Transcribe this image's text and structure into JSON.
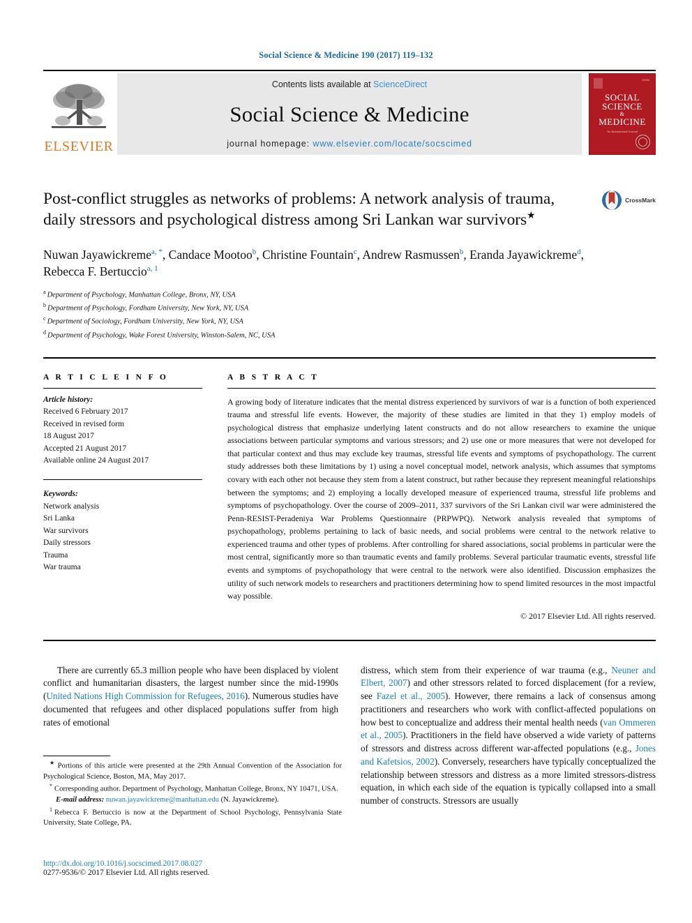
{
  "running_head": "Social Science & Medicine 190 (2017) 119–132",
  "masthead": {
    "publisher_name": "ELSEVIER",
    "publisher_logo_icon": "elsevier-tree-icon",
    "contents_prefix": "Contents lists available at ",
    "contents_link": "ScienceDirect",
    "journal_title": "Social Science & Medicine",
    "homepage_prefix": "journal homepage: ",
    "homepage_url": "www.elsevier.com/locate/socscimed",
    "cover": {
      "line1": "SOCIAL",
      "line2": "SCIENCE",
      "amp": "&",
      "line3": "MEDICINE",
      "tagline": "An International Journal",
      "top_mark": "ISSN"
    }
  },
  "article": {
    "title": "Post-conflict struggles as networks of problems: A network analysis of trauma, daily stressors and psychological distress among Sri Lankan war survivors",
    "title_star": "★",
    "crossmark_label": "CrossMark",
    "authors_line1": "Nuwan Jayawickreme",
    "authors": [
      {
        "name": "Nuwan Jayawickreme",
        "marks": "a, *"
      },
      {
        "name": "Candace Mootoo",
        "marks": "b"
      },
      {
        "name": "Christine Fountain",
        "marks": "c"
      },
      {
        "name": "Andrew Rasmussen",
        "marks": "b"
      },
      {
        "name": "Eranda Jayawickreme",
        "marks": "d"
      },
      {
        "name": "Rebecca F. Bertuccio",
        "marks": "a, 1"
      }
    ],
    "affiliations": [
      {
        "mark": "a",
        "text": "Department of Psychology, Manhattan College, Bronx, NY, USA"
      },
      {
        "mark": "b",
        "text": "Department of Psychology, Fordham University, New York, NY, USA"
      },
      {
        "mark": "c",
        "text": "Department of Sociology, Fordham University, New York, NY, USA"
      },
      {
        "mark": "d",
        "text": "Department of Psychology, Wake Forest University, Winston-Salem, NC, USA"
      }
    ]
  },
  "article_info": {
    "heading": "A R T I C L E   I N F O",
    "history_label": "Article history:",
    "history": [
      "Received 6 February 2017",
      "Received in revised form",
      "18 August 2017",
      "Accepted 21 August 2017",
      "Available online 24 August 2017"
    ],
    "keywords_label": "Keywords:",
    "keywords": [
      "Network analysis",
      "Sri Lanka",
      "War survivors",
      "Daily stressors",
      "Trauma",
      "War trauma"
    ]
  },
  "abstract": {
    "heading": "A B S T R A C T",
    "text": "A growing body of literature indicates that the mental distress experienced by survivors of war is a function of both experienced trauma and stressful life events. However, the majority of these studies are limited in that they 1) employ models of psychological distress that emphasize underlying latent constructs and do not allow researchers to examine the unique associations between particular symptoms and various stressors; and 2) use one or more measures that were not developed for that particular context and thus may exclude key traumas, stressful life events and symptoms of psychopathology. The current study addresses both these limitations by 1) using a novel conceptual model, network analysis, which assumes that symptoms covary with each other not because they stem from a latent construct, but rather because they represent meaningful relationships between the symptoms; and 2) employing a locally developed measure of experienced trauma, stressful life problems and symptoms of psychopathology. Over the course of 2009–2011, 337 survivors of the Sri Lankan civil war were administered the Penn-RESIST-Peradeniya War Problems Questionnaire (PRPWPQ). Network analysis revealed that symptoms of psychopathology, problems pertaining to lack of basic needs, and social problems were central to the network relative to experienced trauma and other types of problems. After controlling for shared associations, social problems in particular were the most central, significantly more so than traumatic events and family problems. Several particular traumatic events, stressful life events and symptoms of psychopathology that were central to the network were also identified. Discussion emphasizes the utility of such network models to researchers and practitioners determining how to spend limited resources in the most impactful way possible.",
    "copyright": "© 2017 Elsevier Ltd. All rights reserved."
  },
  "body": {
    "left_column": {
      "seg1": "There are currently 65.3 million people who have been displaced by violent conflict and humanitarian disasters, the largest number since the mid-1990s (",
      "cite1": "United Nations High Commission for Refugees, 2016",
      "seg2": "). Numerous studies have documented that refugees and other displaced populations suffer from high rates of emotional"
    },
    "right_column": {
      "seg1": "distress, which stem from their experience of war trauma (e.g., ",
      "cite1": "Neuner and Elbert, 2007",
      "seg2": ") and other stressors related to forced displacement (for a review, see ",
      "cite2": "Fazel et al., 2005",
      "seg3": "). However, there remains a lack of consensus among practitioners and researchers who work with conflict-affected populations on how best to conceptualize and address their mental health needs (",
      "cite3": "van Ommeren et al., 2005",
      "seg4": "). Practitioners in the field have observed a wide variety of patterns of stressors and distress across different war-affected populations (e.g., ",
      "cite4": "Jones and Kafetsios, 2002",
      "seg5": "). Conversely, researchers have typically conceptualized the relationship between stressors and distress as a more limited stressors-distress equation, in which each side of the equation is typically collapsed into a small number of constructs. Stressors are usually"
    }
  },
  "footnotes": [
    {
      "mark": "★",
      "text": "Portions of this article were presented at the 29th Annual Convention of the Association for Psychological Science, Boston, MA, May 2017."
    },
    {
      "mark": "*",
      "text": "Corresponding author. Department of Psychology, Manhattan College, Bronx, NY 10471, USA."
    }
  ],
  "email_note": {
    "label": "E-mail address:",
    "email": "nuwan.jayawickreme@manhattan.edu",
    "suffix": " (N. Jayawickreme)."
  },
  "footnote_present_address": {
    "mark": "1",
    "text": "Rebecca F. Bertuccio is now at the Department of School Psychology, Pennsylvania State University, State College, PA."
  },
  "doi": {
    "url": "http://dx.doi.org/10.1016/j.socscimed.2017.08.027",
    "issn_line": "0277-9536/© 2017 Elsevier Ltd. All rights reserved."
  },
  "colors": {
    "link": "#1a7fc1",
    "running_head": "#1a6ca8",
    "elsevier_orange": "#E87722",
    "cover_red": "#b01b23",
    "masthead_grey": "#e8e8e8"
  }
}
